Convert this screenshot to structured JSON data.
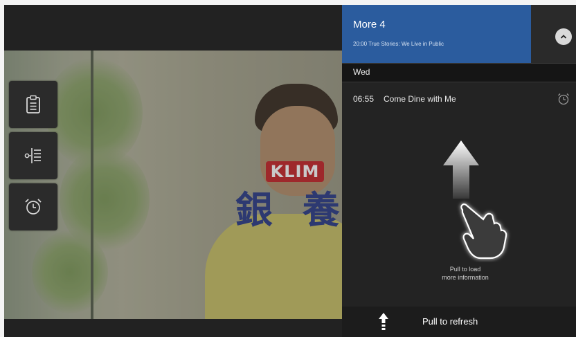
{
  "video": {
    "logo_text": "KLIM",
    "caption_text": "銀 養"
  },
  "side_buttons": [
    {
      "icon": "program-info-icon"
    },
    {
      "icon": "channel-list-icon"
    },
    {
      "icon": "alarm-clock-icon"
    }
  ],
  "panel": {
    "channel_name": "More 4",
    "now_playing": "20:00   True Stories: We Live in Public",
    "day_label": "Wed",
    "programme": {
      "time": "06:55",
      "title": "Come Dine with Me"
    },
    "pull_hint": "Pull to load\nmore information",
    "refresh_label": "Pull to refresh"
  },
  "colors": {
    "channel_header": "#2b5c9e",
    "panel_bg": "#232323"
  }
}
